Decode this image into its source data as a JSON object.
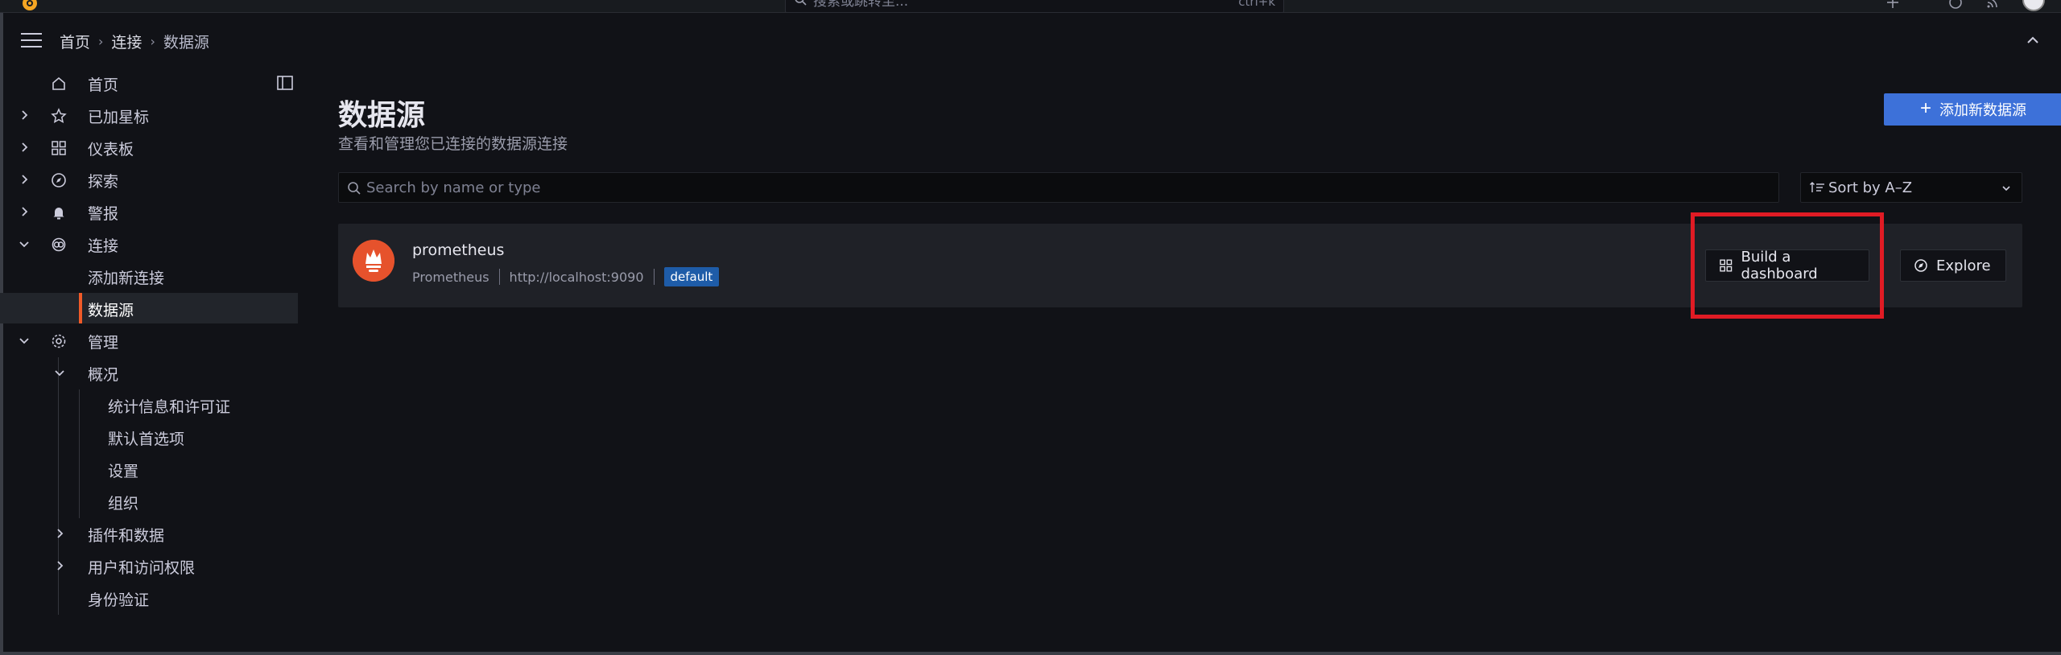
{
  "topbar": {
    "search_placeholder": "搜索或跳转至...",
    "search_shortcut": "ctrl+k"
  },
  "breadcrumb": {
    "items": [
      "首页",
      "连接",
      "数据源"
    ]
  },
  "sidebar": {
    "items": [
      {
        "label": "首页",
        "icon": "home-icon"
      },
      {
        "label": "已加星标",
        "icon": "star-icon"
      },
      {
        "label": "仪表板",
        "icon": "apps-icon"
      },
      {
        "label": "探索",
        "icon": "compass-icon"
      },
      {
        "label": "警报",
        "icon": "bell-icon"
      },
      {
        "label": "连接",
        "icon": "link-icon"
      },
      {
        "label": "添加新连接"
      },
      {
        "label": "数据源"
      },
      {
        "label": "管理",
        "icon": "cog-icon"
      },
      {
        "label": "概况"
      },
      {
        "label": "统计信息和许可证"
      },
      {
        "label": "默认首选项"
      },
      {
        "label": "设置"
      },
      {
        "label": "组织"
      },
      {
        "label": "插件和数据"
      },
      {
        "label": "用户和访问权限"
      },
      {
        "label": "身份验证"
      }
    ]
  },
  "page": {
    "title": "数据源",
    "subtitle": "查看和管理您已连接的数据源连接",
    "add_button": "添加新数据源",
    "search_placeholder": "Search by name or type",
    "sort_label": "Sort by A–Z"
  },
  "datasources": [
    {
      "name": "prometheus",
      "type": "Prometheus",
      "url": "http://localhost:9090",
      "badge": "default",
      "build_button": "Build a dashboard",
      "explore_button": "Explore"
    }
  ],
  "colors": {
    "accent": "#3d71d9",
    "active_marker": "#f05a28",
    "prometheus_logo": "#e6522c",
    "highlight_box": "#e01b24",
    "badge": "#1e5ca8"
  }
}
